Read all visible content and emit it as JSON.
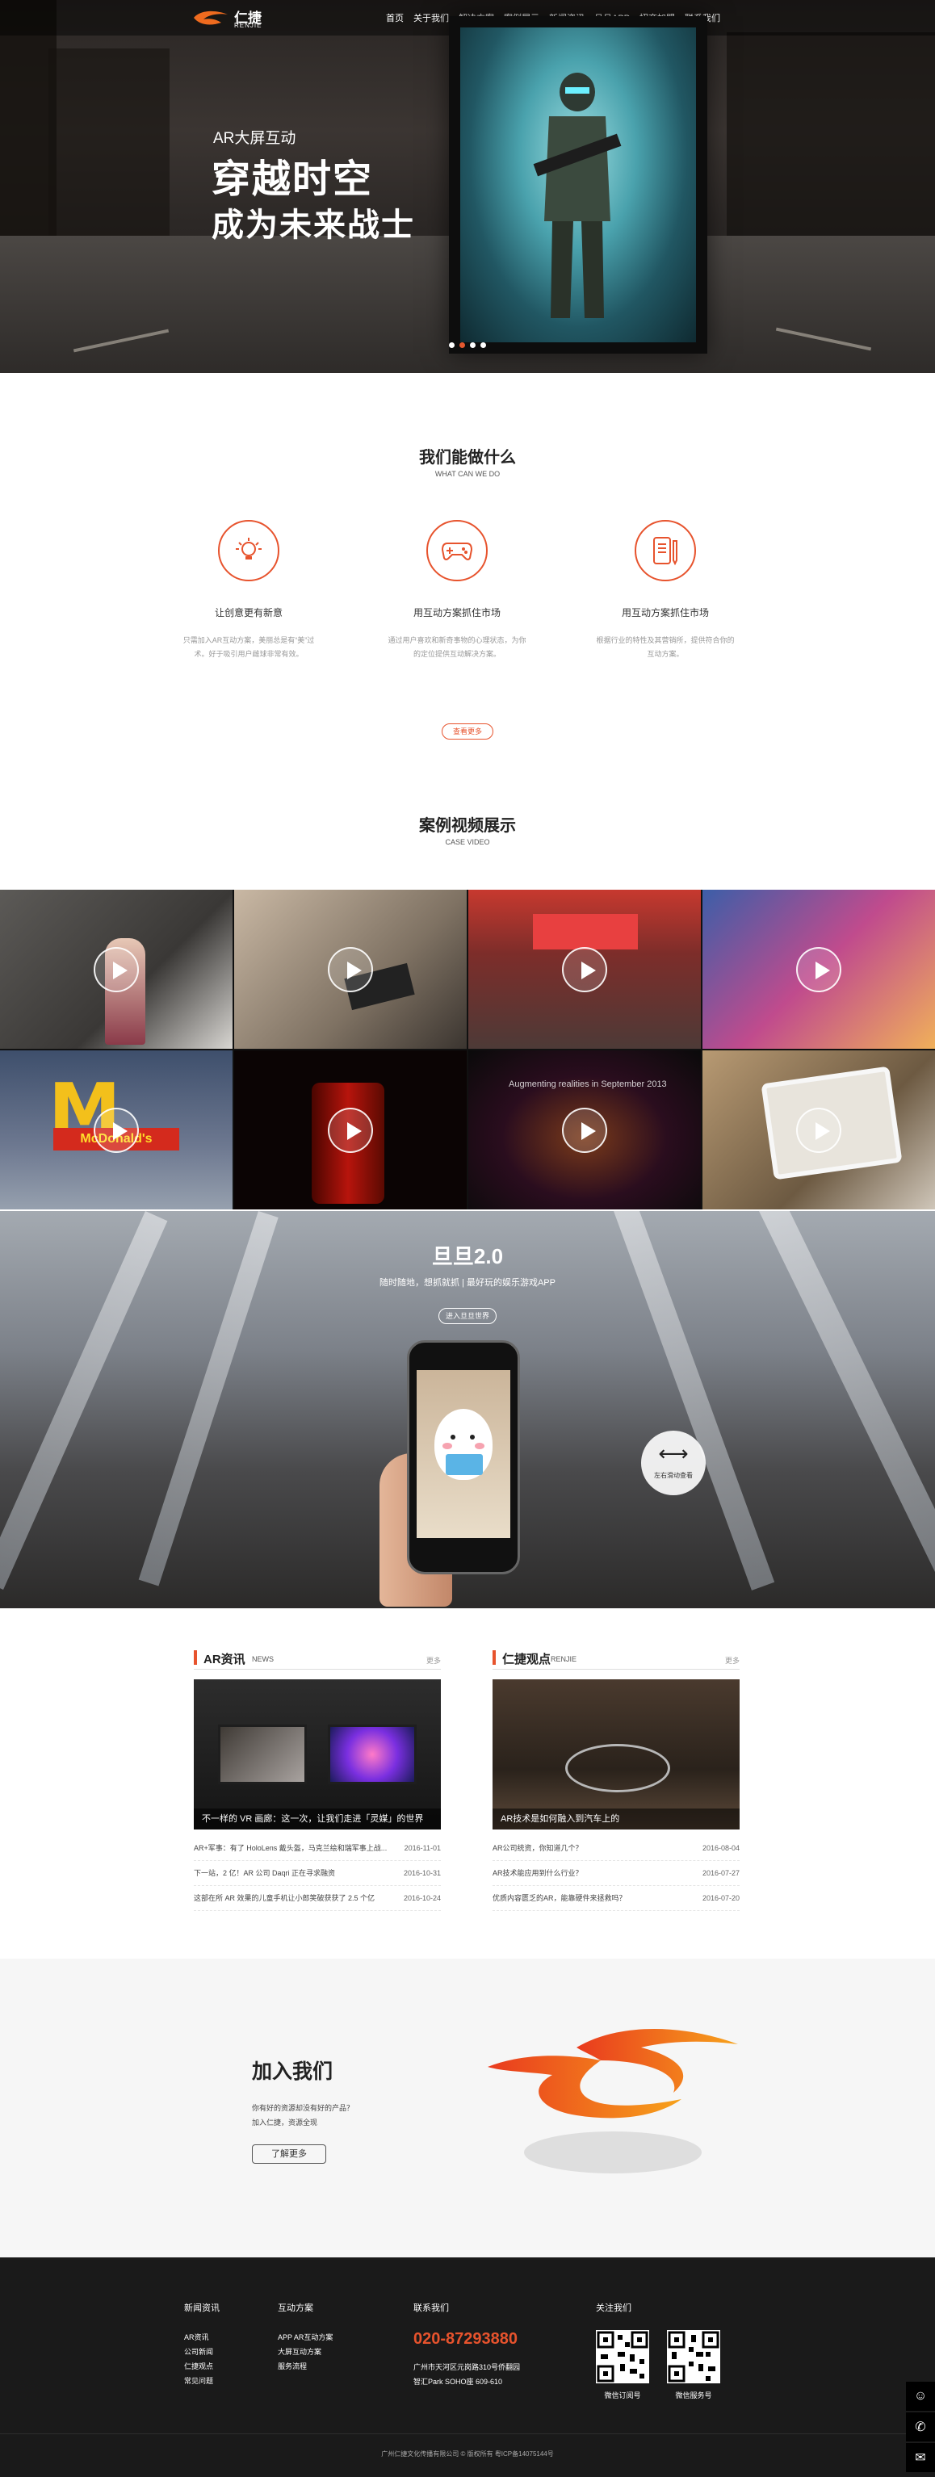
{
  "header": {
    "logo_cn": "仁捷",
    "logo_en": "RENJIE",
    "nav": [
      "首页",
      "关于我们",
      "解决方案",
      "案例展示",
      "新闻资讯",
      "旦旦APP",
      "招商加盟",
      "联系我们"
    ]
  },
  "hero": {
    "subtitle": "AR大屏互动",
    "title_line1": "穿越时空",
    "title_line2": "成为未来战士",
    "slides": 4,
    "active_slide": 1
  },
  "services": {
    "title": "我们能做什么",
    "subtitle": "WHAT CAN WE DO",
    "items": [
      {
        "icon": "lightbulb-icon",
        "title": "让创意更有新意",
        "desc": "只需加入AR互动方案，美丽总是有“美”过术。好于吸引用户雌球非常有效。"
      },
      {
        "icon": "gamepad-icon",
        "title": "用互动方案抓住市场",
        "desc": "通过用户喜欢和新奇事物的心理状态，为你的定位提供互动解决方案。"
      },
      {
        "icon": "phone-pencil-icon",
        "title": "用互动方案抓住市场",
        "desc": "根据行业的特性及其营销所，提供符合你的互动方案。"
      }
    ],
    "more_label": "查看更多"
  },
  "cases": {
    "title": "案例视频展示",
    "subtitle": "CASE VIDEO",
    "tiles": [
      {
        "name": "tile-fashion-store",
        "caption": ""
      },
      {
        "name": "tile-hand-table",
        "caption": ""
      },
      {
        "name": "tile-mall-event",
        "caption": ""
      },
      {
        "name": "tile-colorful-wall",
        "caption": ""
      },
      {
        "name": "tile-mcdonalds",
        "caption": "McDonald's"
      },
      {
        "name": "tile-coca-cola",
        "caption": ""
      },
      {
        "name": "tile-augmenting-realities",
        "caption": "Augmenting realities in September 2013"
      },
      {
        "name": "tile-tablet-ar",
        "caption": ""
      }
    ]
  },
  "app": {
    "title": "旦旦2.0",
    "subtitle": "随时随地，想抓就抓 | 最好玩的娱乐游戏APP",
    "button": "进入旦旦世界",
    "swipe_label": "左右滑动查看"
  },
  "news": {
    "left": {
      "title": "AR资讯",
      "en": "NEWS",
      "more": "更多",
      "image_caption": "不一样的 VR 画廊：这一次，让我们走进「灵媒」的世界",
      "items": [
        {
          "text": "AR+军事：有了 HoloLens 戴头盔，马克兰绘和瑞军事上战...",
          "date": "2016-11-01"
        },
        {
          "text": "下一站，2 亿！AR 公司 Daqri 正在寻求融资",
          "date": "2016-10-31"
        },
        {
          "text": "这部在所 AR 效果的儿童手机让小郎笑破获获了 2.5 个亿",
          "date": "2016-10-24"
        }
      ]
    },
    "right": {
      "title": "仁捷观点",
      "en": "RENJIE",
      "more": "更多",
      "image_caption": "AR技术是如何融入到汽车上的",
      "items": [
        {
          "text": "AR公司统资，你知道几个？",
          "date": "2016-08-04"
        },
        {
          "text": "AR技术能应用到什么行业？",
          "date": "2016-07-27"
        },
        {
          "text": "优质内容匮乏的AR，能靠硬件来拯救吗？",
          "date": "2016-07-20"
        }
      ]
    }
  },
  "join": {
    "title": "加入我们",
    "desc_line1": "你有好的资源却没有好的产品？",
    "desc_line2": "加入仁捷，资源全现",
    "button": "了解更多"
  },
  "footer": {
    "col1": {
      "title": "新闻资讯",
      "items": [
        "AR资讯",
        "公司新闻",
        "仁捷观点",
        "常见问题"
      ]
    },
    "col2": {
      "title": "互动方案",
      "items": [
        "APP AR互动方案",
        "大屏互动方案",
        "服务流程"
      ]
    },
    "contact": {
      "title": "联系我们",
      "phone": "020-87293880",
      "addr1": "广州市天河区元岗路310号侨翻园",
      "addr2": "智汇Park SOHO座 609-610"
    },
    "follow": {
      "title": "关注我们",
      "qr1": "微信订阅号",
      "qr2": "微信服务号"
    },
    "copyright": "广州仁捷文化传播有限公司 © 版权所有 粤ICP备14075144号"
  },
  "colors": {
    "accent": "#e7532d",
    "footer_bg": "#1a1a1a"
  }
}
